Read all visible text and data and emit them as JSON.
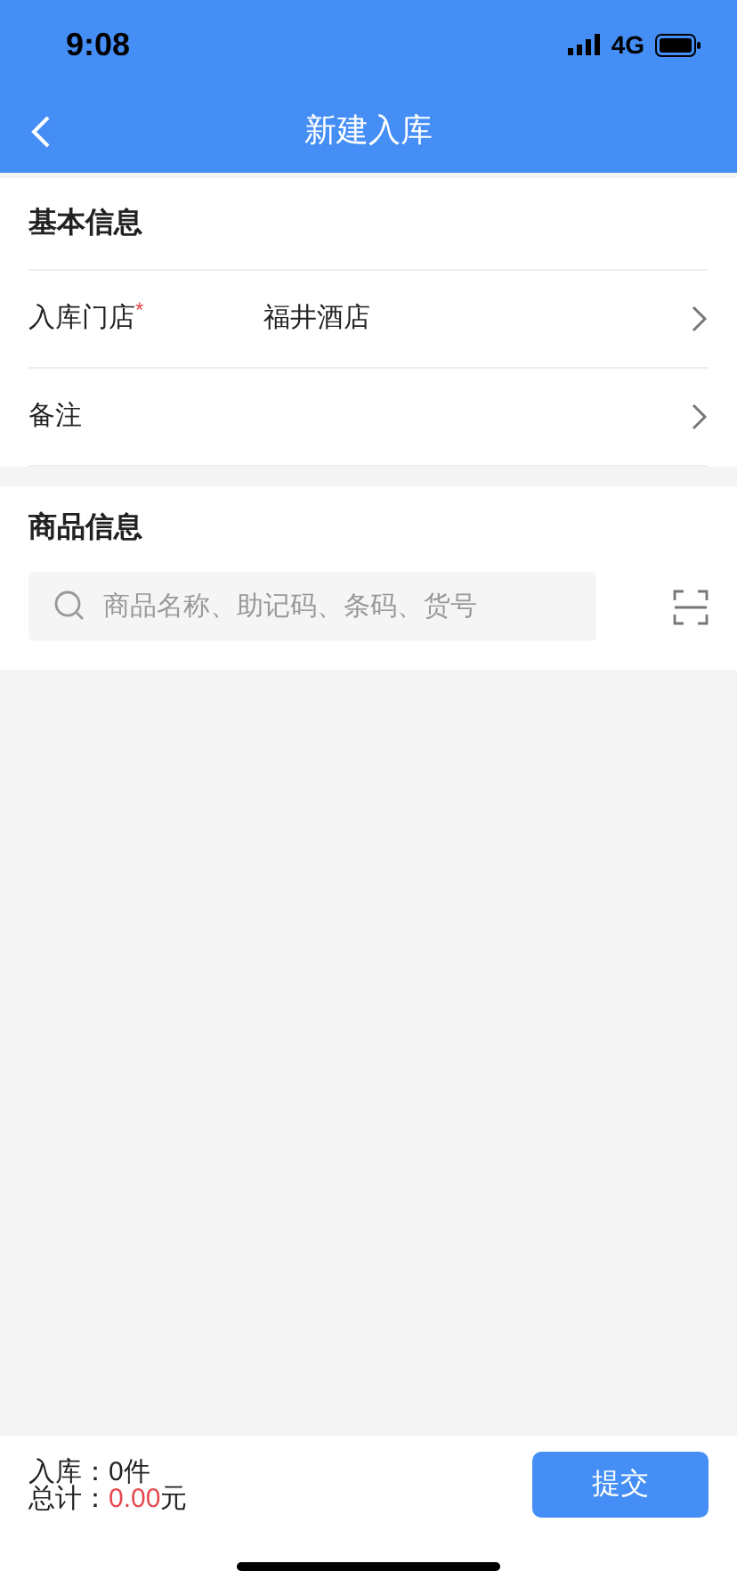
{
  "status_bar": {
    "time": "9:08",
    "network": "4G"
  },
  "nav": {
    "title": "新建入库"
  },
  "basic_info": {
    "title": "基本信息",
    "rows": [
      {
        "label": "入库门店",
        "required_mark": "*",
        "value": "福井酒店"
      },
      {
        "label": "备注"
      }
    ]
  },
  "goods_info": {
    "title": "商品信息",
    "search": {
      "placeholder": "商品名称、助记码、条码、货号"
    }
  },
  "footer": {
    "count_label": "入库：",
    "count_value": "0件",
    "total_label": "总计：",
    "total_value": "0.00",
    "total_unit": "元",
    "submit": "提交"
  }
}
